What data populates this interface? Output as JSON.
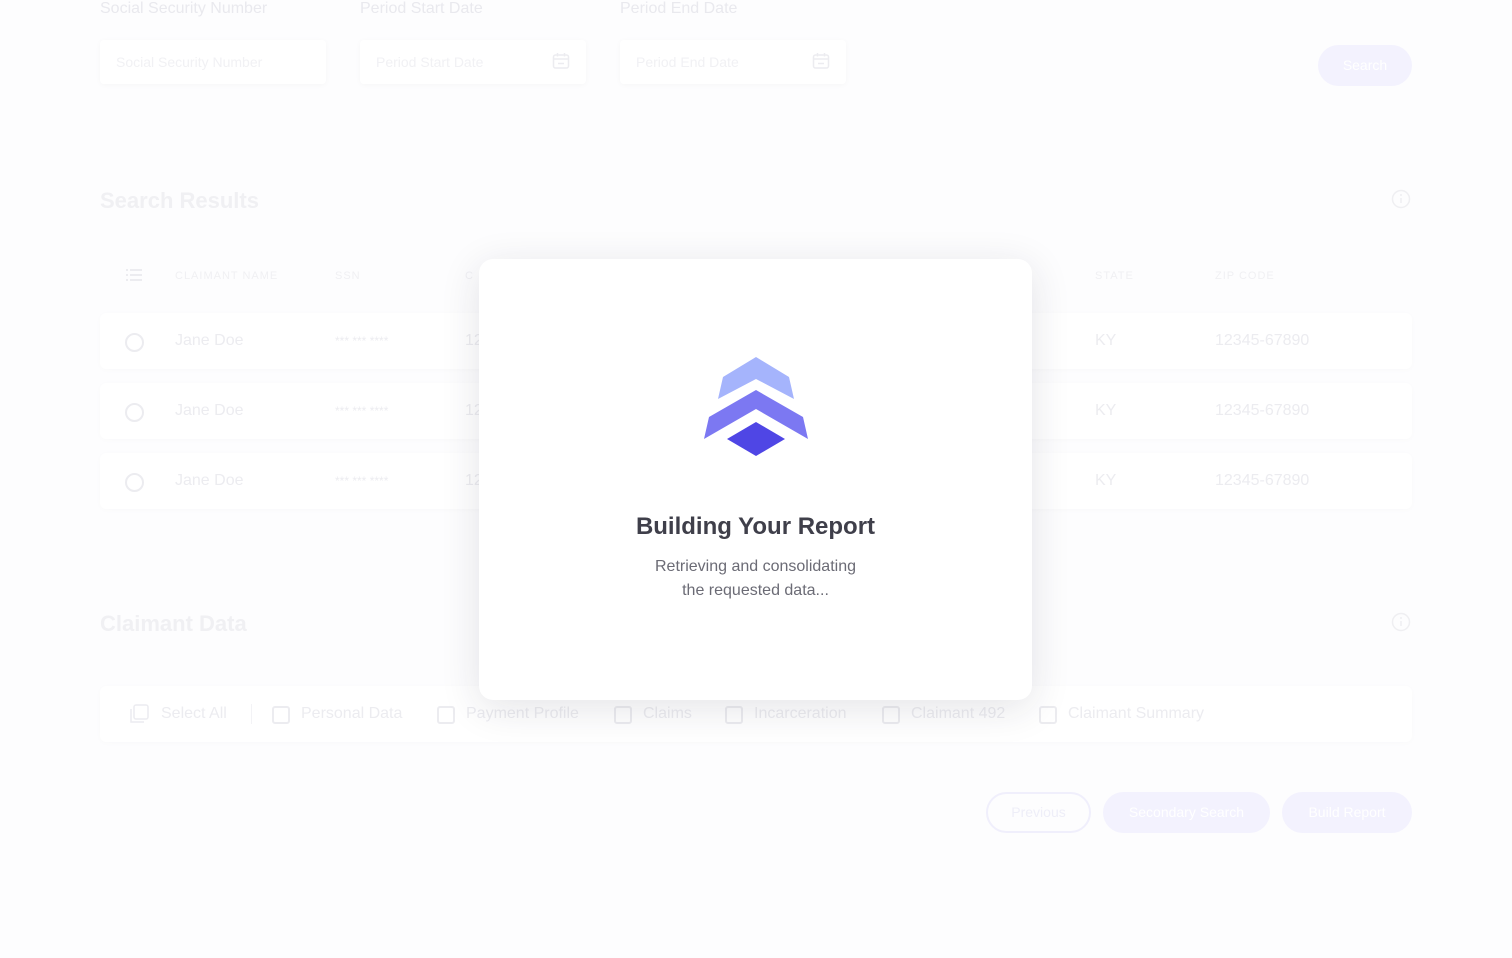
{
  "search_form": {
    "ssn_label": "Social Security Number",
    "ssn_placeholder": "Social Security Number",
    "start_label": "Period Start Date",
    "start_placeholder": "Period Start Date",
    "end_label": "Period End Date",
    "end_placeholder": "Period End Date",
    "search_button": "Search"
  },
  "search_results": {
    "title": "Search Results",
    "columns": [
      "CLAIMANT NAME",
      "SSN",
      "C",
      "STATE",
      "ZIP CODE"
    ],
    "rows": [
      {
        "name": "Jane Doe",
        "ssn": "*** *** ****",
        "partial": "12",
        "state": "KY",
        "zip": "12345-67890"
      },
      {
        "name": "Jane Doe",
        "ssn": "*** *** ****",
        "partial": "12",
        "state": "KY",
        "zip": "12345-67890"
      },
      {
        "name": "Jane Doe",
        "ssn": "*** *** ****",
        "partial": "12",
        "state": "KY",
        "zip": "12345-67890"
      }
    ]
  },
  "claimant_data": {
    "title": "Claimant Data",
    "select_all": "Select All",
    "options": [
      "Personal Data",
      "Payment Profile",
      "Claims",
      "Incarceration",
      "Claimant 492",
      "Claimant Summary"
    ]
  },
  "actions": {
    "previous": "Previous",
    "secondary_search": "Secondary Search",
    "build_report": "Build Report"
  },
  "modal": {
    "title": "Building Your Report",
    "message_line1": "Retrieving and consolidating",
    "message_line2": "the requested data...",
    "logo_icon": "layered-chevron-logo-icon"
  },
  "colors": {
    "accent": "#4f46e5",
    "accent_mid": "#7c78f2",
    "accent_light": "#a5b4fc"
  }
}
